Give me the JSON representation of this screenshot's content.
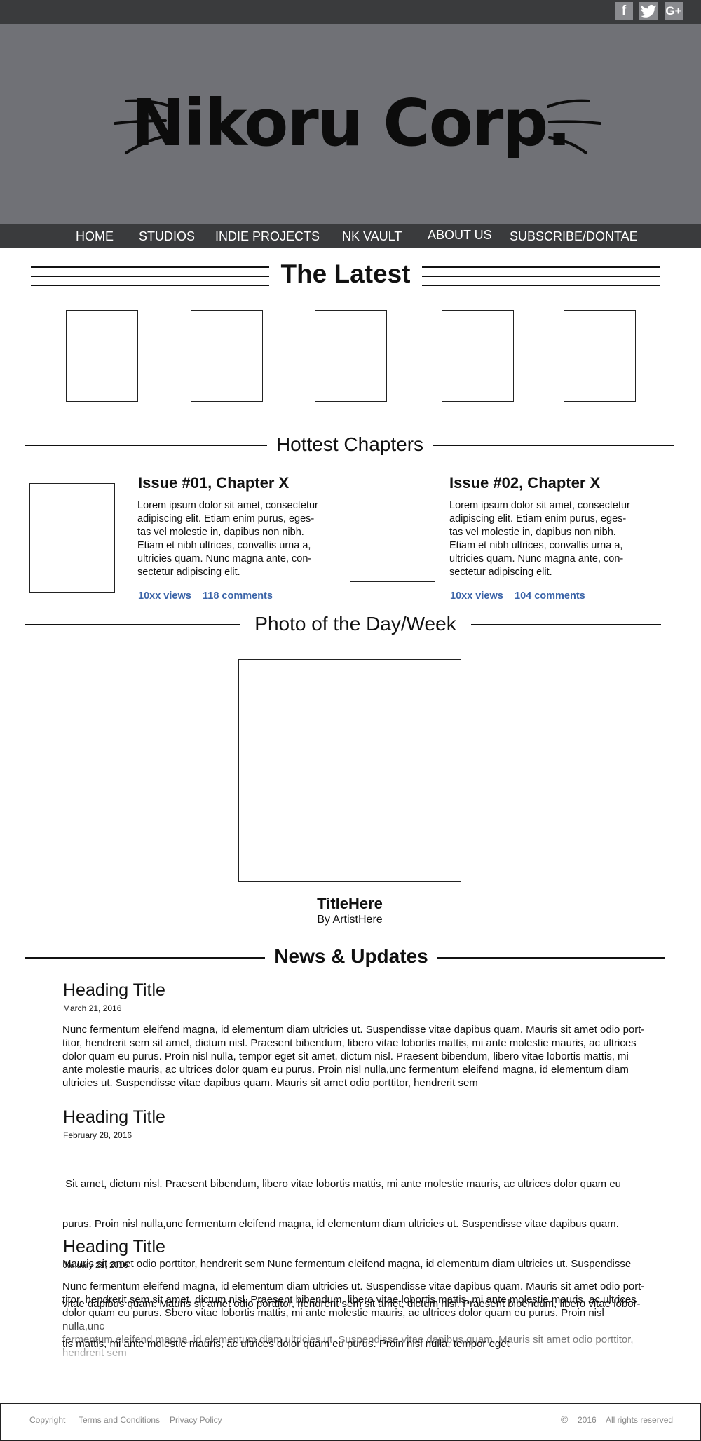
{
  "social": {
    "facebook": "f",
    "twitter": "t",
    "google_plus": "G+"
  },
  "brand": {
    "name": "Nikoru Corp."
  },
  "nav": [
    "HOME",
    "STUDIOS",
    "INDIE PROJECTS",
    "NK VAULT",
    "ABOUT US",
    "SUBSCRIBE/DONTAE"
  ],
  "latest": {
    "title": "The Latest"
  },
  "hottest": {
    "title": "Hottest Chapters",
    "chapters": [
      {
        "title": "Issue #01, Chapter X",
        "lines": [
          "Lorem ipsum dolor sit amet, consectetur",
          "adipiscing elit. Etiam enim purus, eges-",
          "tas vel molestie in, dapibus non nibh.",
          "Etiam et nibh ultrices, convallis urna a,",
          "ultricies quam. Nunc magna ante,  con-",
          "sectetur adipiscing elit."
        ],
        "views": "10xx views",
        "comments": "118 comments"
      },
      {
        "title": "Issue #02, Chapter X",
        "lines": [
          "Lorem ipsum dolor sit amet, consectetur",
          "adipiscing elit. Etiam enim purus, eges-",
          "tas vel molestie in, dapibus non nibh.",
          "Etiam et nibh ultrices, convallis urna a,",
          "ultricies quam. Nunc magna ante,  con-",
          "sectetur adipiscing elit."
        ],
        "views": "10xx views",
        "comments": "104 comments"
      }
    ]
  },
  "photo": {
    "title": "Photo of the Day/Week",
    "caption_title": "TitleHere",
    "caption_artist": "By ArtistHere"
  },
  "news": {
    "title": "News & Updates",
    "items": [
      {
        "heading": "Heading Title",
        "date": "March 21, 2016",
        "lines": [
          "Nunc fermentum eleifend magna, id elementum diam ultricies ut. Suspendisse vitae dapibus quam. Mauris sit amet odio port-",
          "titor, hendrerit sem sit amet, dictum nisl. Praesent bibendum, libero vitae lobortis mattis, mi ante molestie mauris, ac ultrices",
          "dolor quam eu purus. Proin nisl nulla, tempor eget  sit amet, dictum nisl. Praesent bibendum, libero vitae lobortis mattis, mi",
          "ante molestie mauris, ac ultrices dolor quam eu purus. Proin nisl nulla,unc fermentum eleifend magna, id elementum diam",
          "ultricies ut. Suspendisse vitae dapibus quam. Mauris sit amet odio porttitor, hendrerit sem"
        ]
      },
      {
        "heading": "Heading Title",
        "date": "February 28, 2016",
        "lines": [
          " Sit amet, dictum nisl. Praesent bibendum, libero vitae lobortis mattis, mi ante molestie mauris, ac ultrices dolor quam eu",
          "purus. Proin nisl nulla,unc fermentum eleifend magna, id elementum diam ultricies ut. Suspendisse vitae dapibus quam.",
          "Mauris sit amet odio porttitor, hendrerit sem Nunc fermentum eleifend magna, id elementum diam ultricies ut. Suspendisse",
          "vitae dapibus quam. Mauris sit amet odio porttitor, hendrerit sem sit amet, dictum nisl. Praesent bibendum, libero vitae lobor-",
          "tis mattis, mi ante molestie mauris, ac ultrices dolor quam eu purus. Proin nisl nulla, tempor eget"
        ]
      },
      {
        "heading": "Heading Title",
        "date": "January 21, 2016",
        "lines": [
          "Nunc fermentum eleifend magna, id elementum diam ultricies ut. Suspendisse vitae dapibus quam. Mauris sit amet odio port-",
          "titor, hendrerit sem sit amet, dictum nisl. Praesent bibendum, libero vitae lobortis mattis, mi ante molestie mauris, ac ultrices",
          "dolor quam eu purus. Sbero vitae lobortis mattis, mi ante molestie mauris, ac ultrices dolor quam eu purus. Proin nisl nulla,unc",
          "fermentum eleifend magna, id elementum diam ultricies ut. Suspendisse vitae dapibus quam. Mauris sit amet odio porttitor,",
          "hendrerit sem"
        ]
      }
    ]
  },
  "footer": {
    "copyright": "Copyright",
    "terms": "Terms and Conditions",
    "privacy": "Privacy Policy",
    "copyright_symbol": "©",
    "year": "2016",
    "rights": "All rights reserved"
  },
  "colors": {
    "bar": "#3a3b3d",
    "banner": "#707176",
    "link": "#3b64a8"
  }
}
